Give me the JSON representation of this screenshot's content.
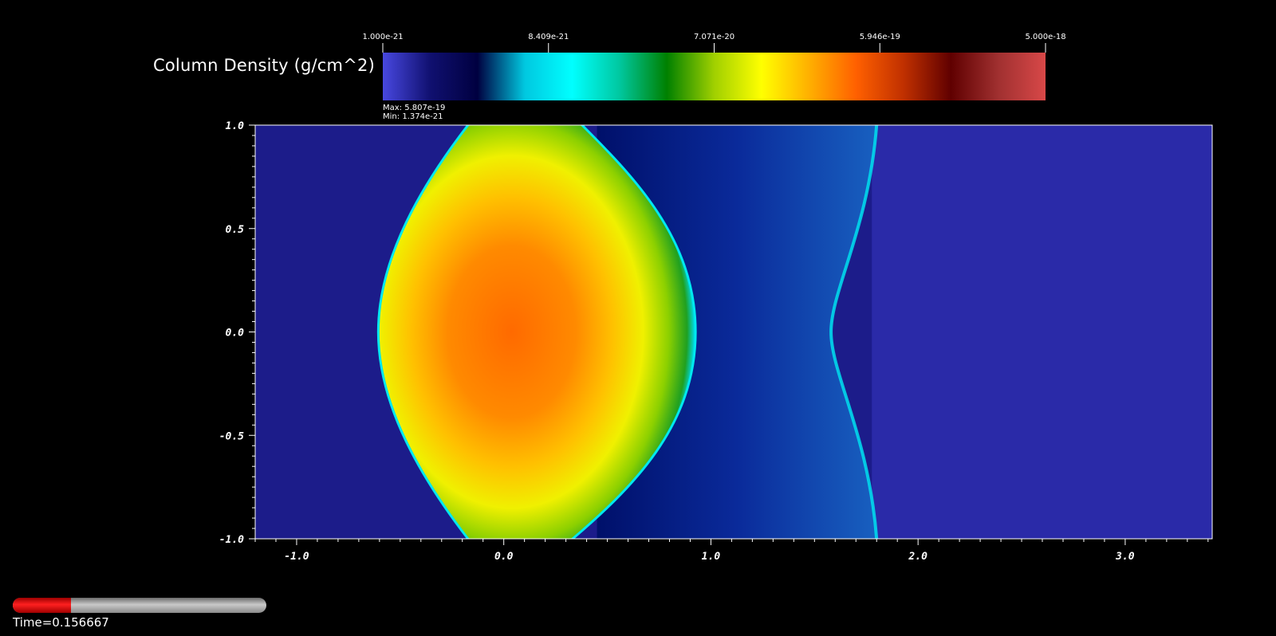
{
  "colorbar": {
    "title": "Column Density (g/cm^2)",
    "tick_labels": [
      "1.000e-21",
      "8.409e-21",
      "7.071e-20",
      "5.946e-19",
      "5.000e-18"
    ],
    "colors": [
      "#4848e0",
      "#101070",
      "#000040",
      "#00c8e0",
      "#00ffff",
      "#00c8a0",
      "#008000",
      "#a0d000",
      "#ffff00",
      "#ffb000",
      "#ff6000",
      "#c03000",
      "#600000",
      "#a03030",
      "#d84848"
    ],
    "scale": "log"
  },
  "stats": {
    "max_label": "Max:",
    "max_value": "5.807e-19",
    "min_label": "Min:",
    "min_value": "1.374e-21"
  },
  "time": {
    "label": "Time=0.156667",
    "progress": 0.23
  },
  "chart_data": {
    "type": "heatmap",
    "xlabel": "",
    "ylabel": "",
    "xlim": [
      -1.2,
      3.42
    ],
    "ylim": [
      -1.0,
      1.0
    ],
    "x_ticks": [
      -1.0,
      0.0,
      1.0,
      2.0,
      3.0
    ],
    "x_tick_labels": [
      "-1.0",
      "0.0",
      "1.0",
      "2.0",
      "3.0"
    ],
    "y_ticks": [
      1.0,
      0.5,
      0.0,
      -0.5,
      -1.0
    ],
    "y_tick_labels": [
      "1.0",
      "0.5",
      "0.0",
      "-0.5",
      "-1.0"
    ],
    "features": {
      "cloud_center": [
        0.05,
        0.0
      ],
      "cloud_bow_left_x": -0.6,
      "cloud_right_x": 0.92,
      "shock_front_x": 1.8,
      "background_low_left": "#1c1c8a",
      "background_right": "#2a2aa8"
    }
  }
}
